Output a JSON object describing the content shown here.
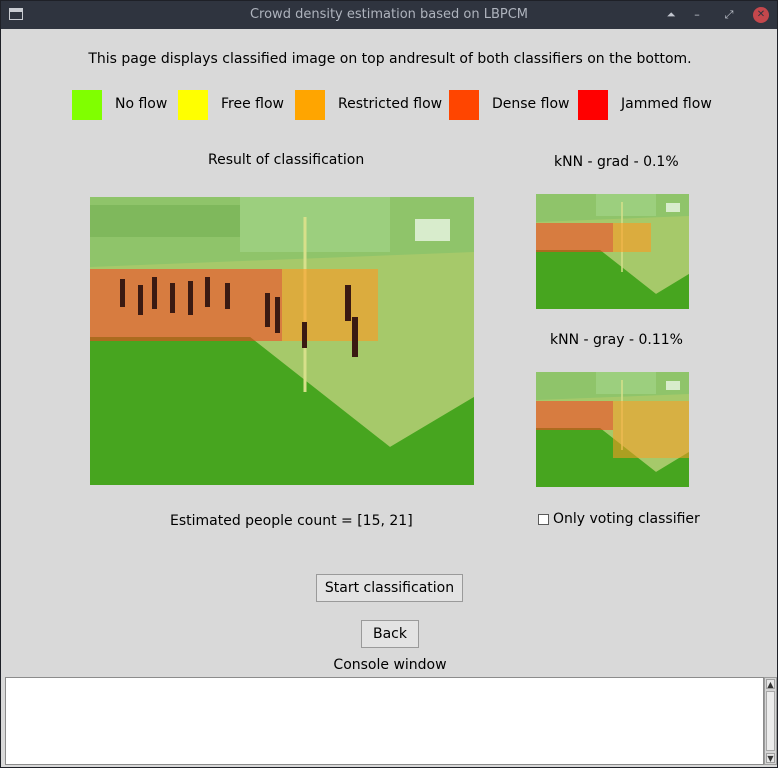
{
  "window": {
    "title": "Crowd density estimation based on LBPCM",
    "buttons": [
      "⏶",
      "–",
      "⤢",
      "✕"
    ]
  },
  "header": {
    "description": "This page displays classified image on top andresult of both classifiers on the bottom."
  },
  "legend": [
    {
      "label": "No flow",
      "color": "#80ff00"
    },
    {
      "label": "Free flow",
      "color": "#ffff00"
    },
    {
      "label": "Restricted flow",
      "color": "#ffa500"
    },
    {
      "label": "Dense flow",
      "color": "#ff4500"
    },
    {
      "label": "Jammed flow",
      "color": "#ff0000"
    }
  ],
  "main": {
    "result_title": "Result of classification",
    "people_count": "Estimated people count = [15, 21]"
  },
  "side": {
    "knn_grad_title": "kNN - grad - 0.1%",
    "knn_gray_title": "kNN - gray - 0.11%",
    "voting_label": "Only voting classifier"
  },
  "actions": {
    "start_label": "Start classification",
    "back_label": "Back"
  },
  "console": {
    "title": "Console window",
    "text": ""
  }
}
